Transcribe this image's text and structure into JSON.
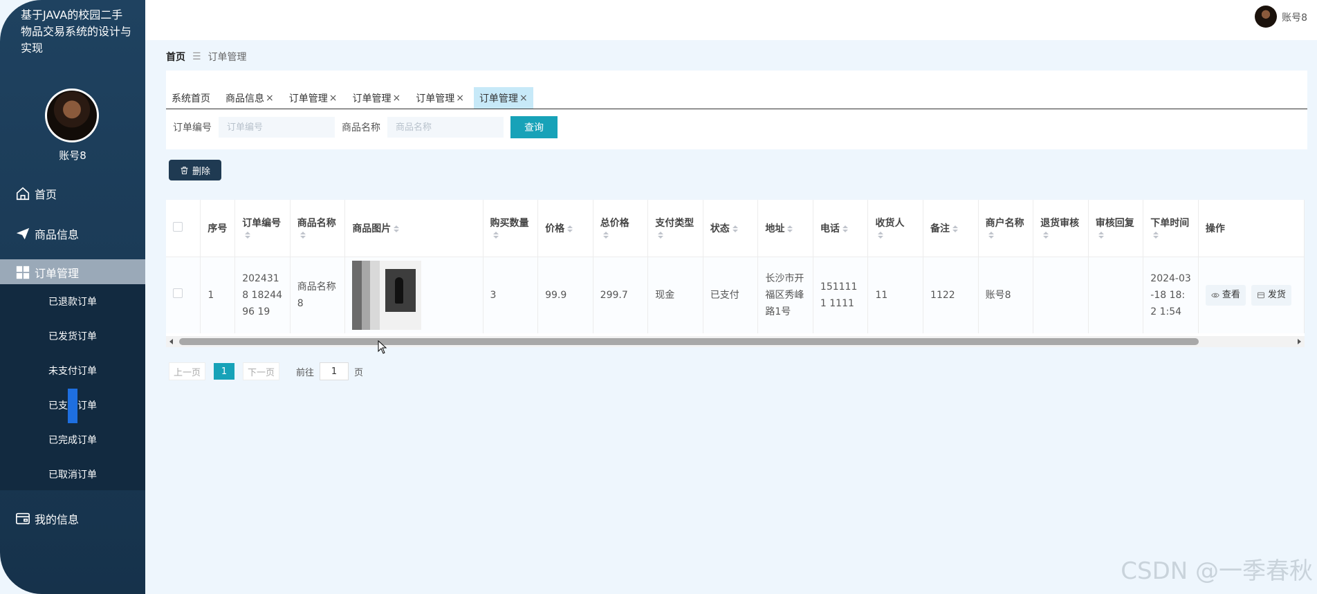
{
  "app": {
    "title": "基于JAVA的校园二手物品交易系统的设计与实现",
    "user_name": "账号8"
  },
  "sidebar": {
    "items": [
      {
        "label": "首页",
        "icon": "home-icon"
      },
      {
        "label": "商品信息",
        "icon": "send-icon"
      },
      {
        "label": "订单管理",
        "icon": "grid-icon",
        "active": true
      },
      {
        "label": "我的信息",
        "icon": "wallet-icon"
      }
    ],
    "submenu": [
      "已退款订单",
      "已发货订单",
      "未支付订单",
      "已支付订单",
      "已完成订单",
      "已取消订单"
    ]
  },
  "topbar": {
    "user_name": "账号8"
  },
  "breadcrumb": {
    "home": "首页",
    "separator": "☰",
    "current": "订单管理"
  },
  "tabs": [
    {
      "label": "系统首页",
      "closable": false
    },
    {
      "label": "商品信息",
      "closable": true
    },
    {
      "label": "订单管理",
      "closable": true
    },
    {
      "label": "订单管理",
      "closable": true
    },
    {
      "label": "订单管理",
      "closable": true
    },
    {
      "label": "订单管理",
      "closable": true,
      "active": true
    }
  ],
  "search": {
    "order_no_label": "订单编号",
    "order_no_placeholder": "订单编号",
    "product_label": "商品名称",
    "product_placeholder": "商品名称",
    "query_button": "查询"
  },
  "actions": {
    "delete_button": "删除"
  },
  "table": {
    "columns": [
      "序号",
      "订单编号",
      "商品名称",
      "商品图片",
      "购买数量",
      "价格",
      "总价格",
      "支付类型",
      "状态",
      "地址",
      "电话",
      "收货人",
      "备注",
      "商户名称",
      "退货审核",
      "审核回复",
      "下单时间",
      "操作"
    ],
    "rows": [
      {
        "index": "1",
        "order_no": "2024318 1824496 19",
        "product_name": "商品名称 8",
        "quantity": "3",
        "price": "99.9",
        "total": "299.7",
        "pay_type": "现金",
        "status": "已支付",
        "address": "长沙市开 福区秀峰 路1号",
        "phone": "1511111 1111",
        "receiver": "11",
        "remark": "1122",
        "merchant": "账号8",
        "return_review": "",
        "review_reply": "",
        "order_time": "2024-03 -18 18:2 1:54",
        "action_view": "查看",
        "action_ship": "发货"
      }
    ]
  },
  "pagination": {
    "prev": "上一页",
    "page": "1",
    "next": "下一页",
    "goto": "前往",
    "goto_value": "1",
    "page_suffix": "页"
  },
  "watermark": "CSDN @一季春秋",
  "colors": {
    "accent": "#17a2b8",
    "sidebar": "#1f4260",
    "delete_button": "#1f3a52",
    "active_tab": "#c7e9f8"
  }
}
